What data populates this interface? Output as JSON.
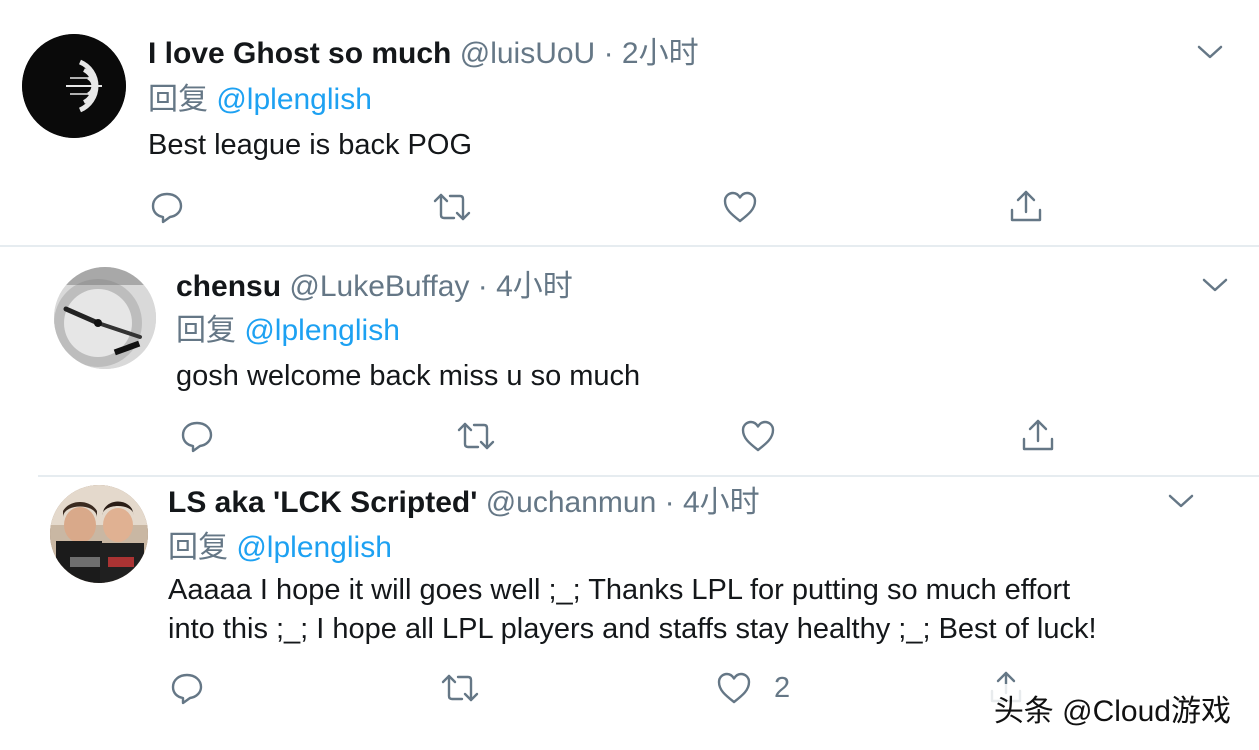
{
  "tweets": [
    {
      "name": "I love Ghost so much",
      "handle": "@luisUoU",
      "sep": "·",
      "time": "2小时",
      "reply_prefix": "回复",
      "reply_to": "@lplenglish",
      "text": "Best league is back POG",
      "like_count": ""
    },
    {
      "name": "chensu",
      "handle": "@LukeBuffay",
      "sep": "·",
      "time": "4小时",
      "reply_prefix": "回复",
      "reply_to": "@lplenglish",
      "text": "gosh welcome back miss u so much",
      "like_count": ""
    },
    {
      "name": "LS aka 'LCK Scripted'",
      "handle": "@uchanmun",
      "sep": "·",
      "time": "4小时",
      "reply_prefix": "回复",
      "reply_to": "@lplenglish",
      "text_line1": "Aaaaa I hope it will goes well ;_; Thanks LPL for putting so much effort",
      "text_line2": "into this ;_; I hope all LPL players and staffs stay healthy ;_; Best of luck!",
      "like_count": "2"
    }
  ],
  "watermark": "头条 @Cloud游戏",
  "icons": {
    "reply": "reply-icon",
    "retweet": "retweet-icon",
    "like": "heart-icon",
    "share": "share-icon",
    "more": "chevron-down-icon"
  },
  "colors": {
    "mention": "#1da1f2",
    "meta": "#657786",
    "text": "#14171a",
    "divider": "#e6ecf0"
  }
}
